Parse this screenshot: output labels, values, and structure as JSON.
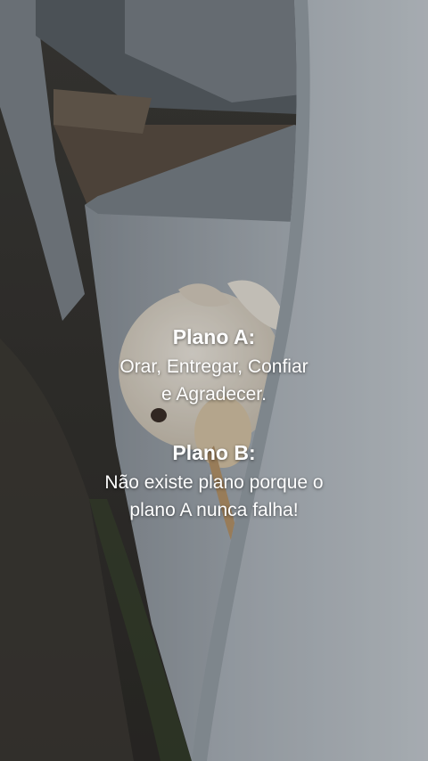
{
  "overlay_text": {
    "plan_a": {
      "title": "Plano A:",
      "lines": [
        "Orar, Entregar, Confiar",
        "e Agradecer."
      ]
    },
    "plan_b": {
      "title": "Plano B:",
      "lines": [
        "Não existe plano porque o",
        "plano A nunca falha!"
      ]
    }
  },
  "colors": {
    "text": "#ffffff",
    "wall": "#b9c0c6",
    "ground": "#3a3a34",
    "dog": "#e6e0d4"
  }
}
